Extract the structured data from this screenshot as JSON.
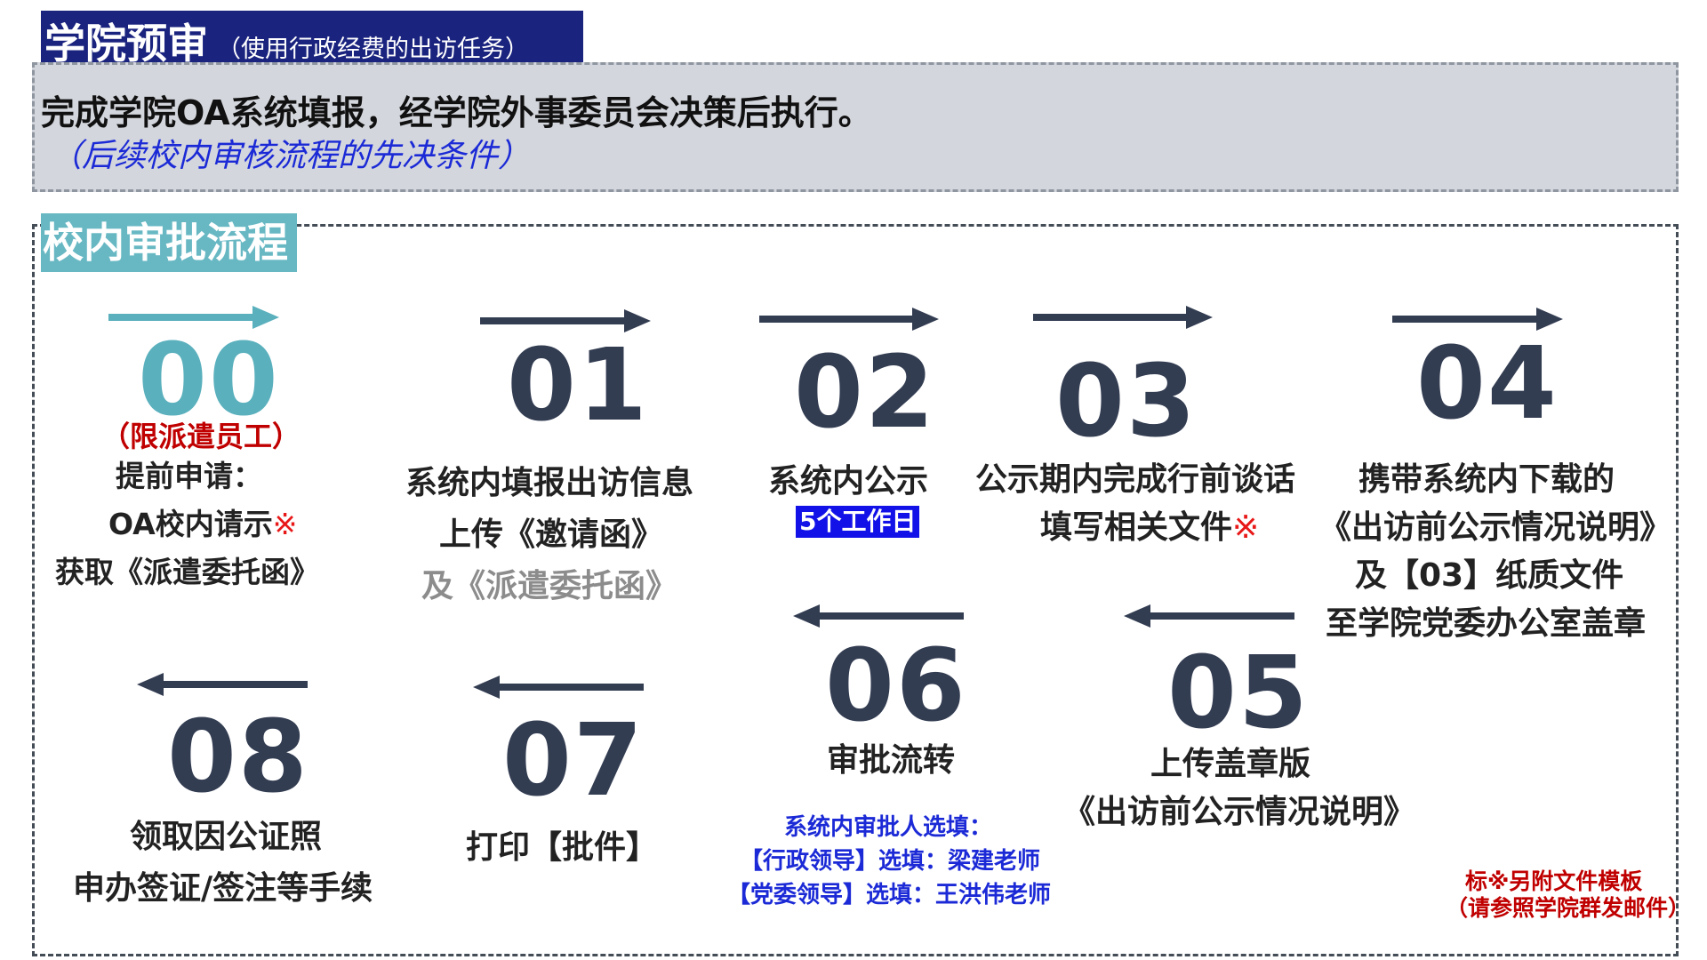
{
  "header": {
    "title": "学院预审",
    "subtitle": "（使用行政经费的出访任务）"
  },
  "pre_review": {
    "main_text": "完成学院OA系统填报，经学院外事委员会决策后执行。",
    "note": "（后续校内审核流程的先决条件）"
  },
  "process": {
    "title": "校内审批流程",
    "steps": {
      "s00": {
        "num": "00",
        "tag": "（限派遣员工）",
        "line1": "提前申请：",
        "line2": "OA校内请示",
        "line2_mark": "※",
        "line3": "获取《派遣委托函》"
      },
      "s01": {
        "num": "01",
        "line1": "系统内填报出访信息",
        "line2": "上传《邀请函》",
        "line3": "及《派遣委托函》"
      },
      "s02": {
        "num": "02",
        "line1": "系统内公示",
        "badge": "5个工作日"
      },
      "s03": {
        "num": "03",
        "line1": "公示期内完成行前谈话",
        "line2": "填写相关文件",
        "line2_mark": "※"
      },
      "s04": {
        "num": "04",
        "line1": "携带系统内下载的",
        "line2": "《出访前公示情况说明》",
        "line3": "及【03】纸质文件",
        "line4": "至学院党委办公室盖章"
      },
      "s05": {
        "num": "05",
        "line1": "上传盖章版",
        "line2": "《出访前公示情况说明》"
      },
      "s06": {
        "num": "06",
        "line1": "审批流转",
        "note1": "系统内审批人选填：",
        "note2": "【行政领导】选填：梁建老师",
        "note3": "【党委领导】选填：王洪伟老师"
      },
      "s07": {
        "num": "07",
        "line1": "打印【批件】"
      },
      "s08": {
        "num": "08",
        "line1": "领取因公证照",
        "line2": "申办签证/签注等手续"
      }
    },
    "footnote": {
      "line1": "标※另附文件模板",
      "line2": "（请参照学院群发邮件）"
    }
  },
  "colors": {
    "title_bg": "#1a237e",
    "process_title_bg": "#68b8c4",
    "step_number": "#333d52",
    "step_number_highlight": "#5ab0bd",
    "blue_text": "#1b2ad6",
    "red_text": "#c00000"
  }
}
